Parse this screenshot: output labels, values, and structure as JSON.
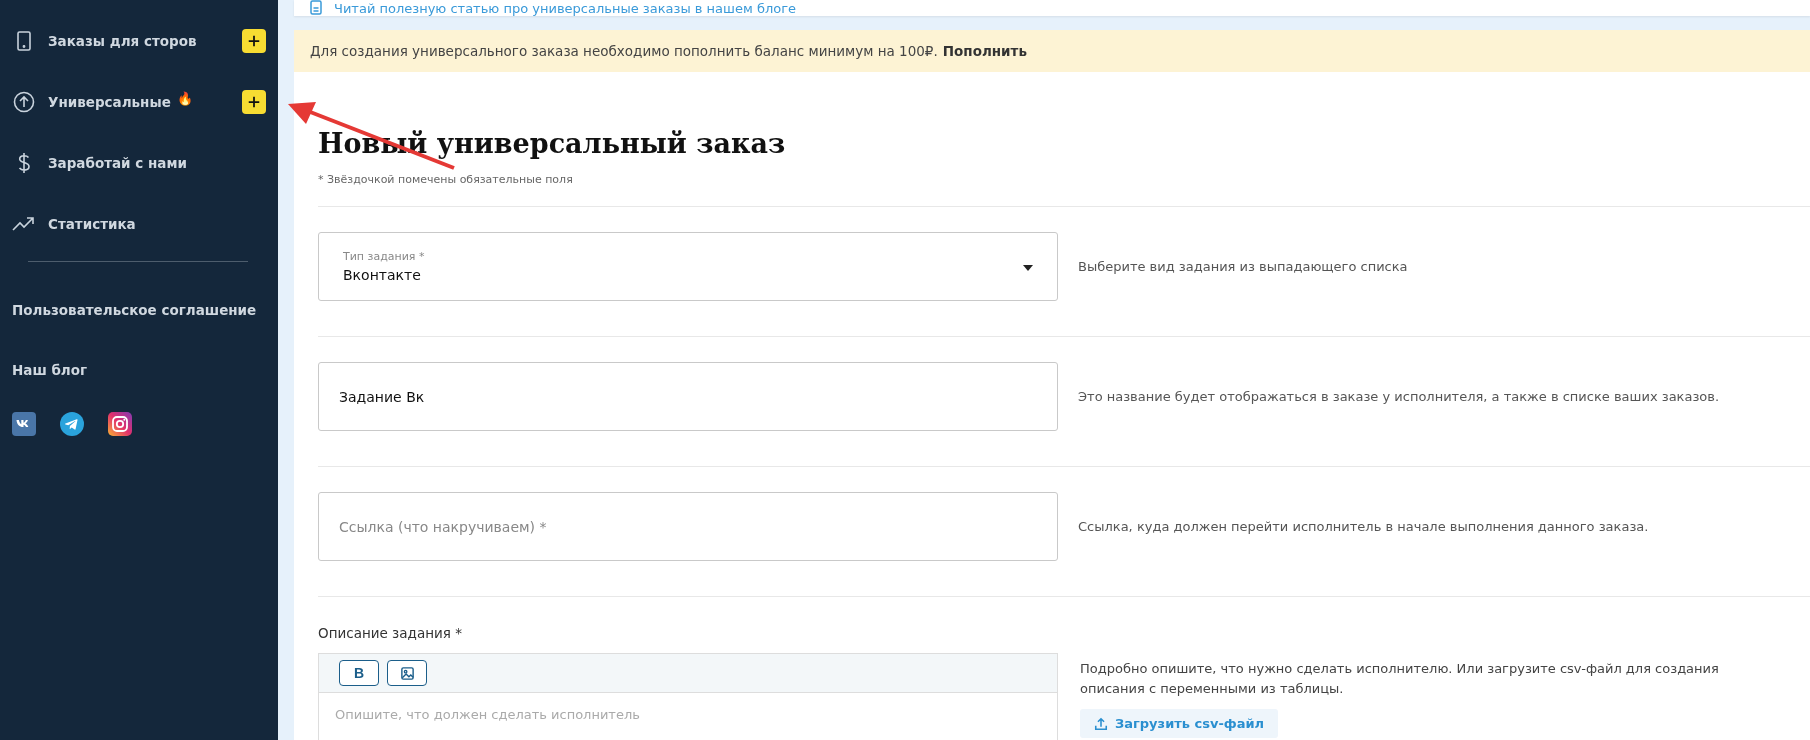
{
  "sidebar": {
    "items": [
      {
        "kind": "phone",
        "label": "Заказы для сторов",
        "add_button": true
      },
      {
        "kind": "upload",
        "label": "Универсальные",
        "add_button": true,
        "badge": "🔥"
      },
      {
        "kind": "dollar",
        "label": "Заработай с нами",
        "add_button": false
      },
      {
        "kind": "chart",
        "label": "Статистика",
        "add_button": false
      }
    ],
    "links": [
      "Пользовательское соглашение",
      "Наш блог"
    ],
    "socials": [
      {
        "kind": "vk"
      },
      {
        "kind": "telegram"
      },
      {
        "kind": "instagram"
      }
    ]
  },
  "blog_link": "Читай полезную статью про универсальные заказы в нашем блоге",
  "notice": {
    "text": "Для создания универсального заказа необходимо пополнить баланс минимум на 100₽.",
    "action": "Пополнить"
  },
  "title": "Новый универсальный заказ",
  "required_note": "* Звёздочкой помечены обязательные поля",
  "fields": [
    {
      "kind": "select",
      "label": "Тип задания *",
      "value": "Вконтакте",
      "hint": "Выберите вид задания из выпадающего списка"
    },
    {
      "kind": "text",
      "value": "Задание Вк",
      "hint": "Это название будет отображаться в заказе у исполнителя, а также в списке ваших заказов."
    },
    {
      "kind": "text",
      "placeholder": "Ссылка (что накручиваем) *",
      "hint": "Ссылка, куда должен перейти исполнитель в начале выполнения данного заказа."
    }
  ],
  "description": {
    "label": "Описание задания *",
    "toolbar": [
      {
        "kind": "bold",
        "label": "B"
      },
      {
        "kind": "image"
      }
    ],
    "placeholder": "Опишите, что должен сделать исполнитель",
    "hint": "Подробно опишите, что нужно сделать исполнителю. Или загрузите csv-файл для создания описания с переменными из таблицы.",
    "upload_button": "Загрузить csv-файл"
  },
  "annotation": {
    "kind": "arrow"
  }
}
